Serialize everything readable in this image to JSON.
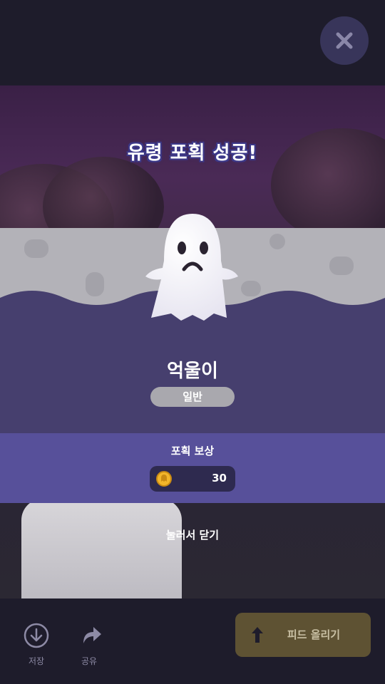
{
  "dialog": {
    "title": "유령 포획 성공!",
    "ghost_name": "억울이",
    "rarity": "일반",
    "reward_label": "포획 보상",
    "reward_amount": "30",
    "dismiss_text": "눌러서 닫기"
  },
  "bottom_bar": {
    "save_label": "저장",
    "share_label": "공유",
    "upload_label": "피드 올리기"
  },
  "icons": {
    "close": "close-icon",
    "coin": "ghost-coin-icon",
    "save": "download-icon",
    "share": "share-arrow-icon",
    "upload": "arrow-up-icon"
  },
  "colors": {
    "background": "#1e1c2b",
    "card_purple": "#463f6e",
    "reward_band": "#57509a",
    "rarity_badge": "#a9a8ae",
    "upload_button": "#5e5233",
    "coin": "#f2b52b"
  }
}
